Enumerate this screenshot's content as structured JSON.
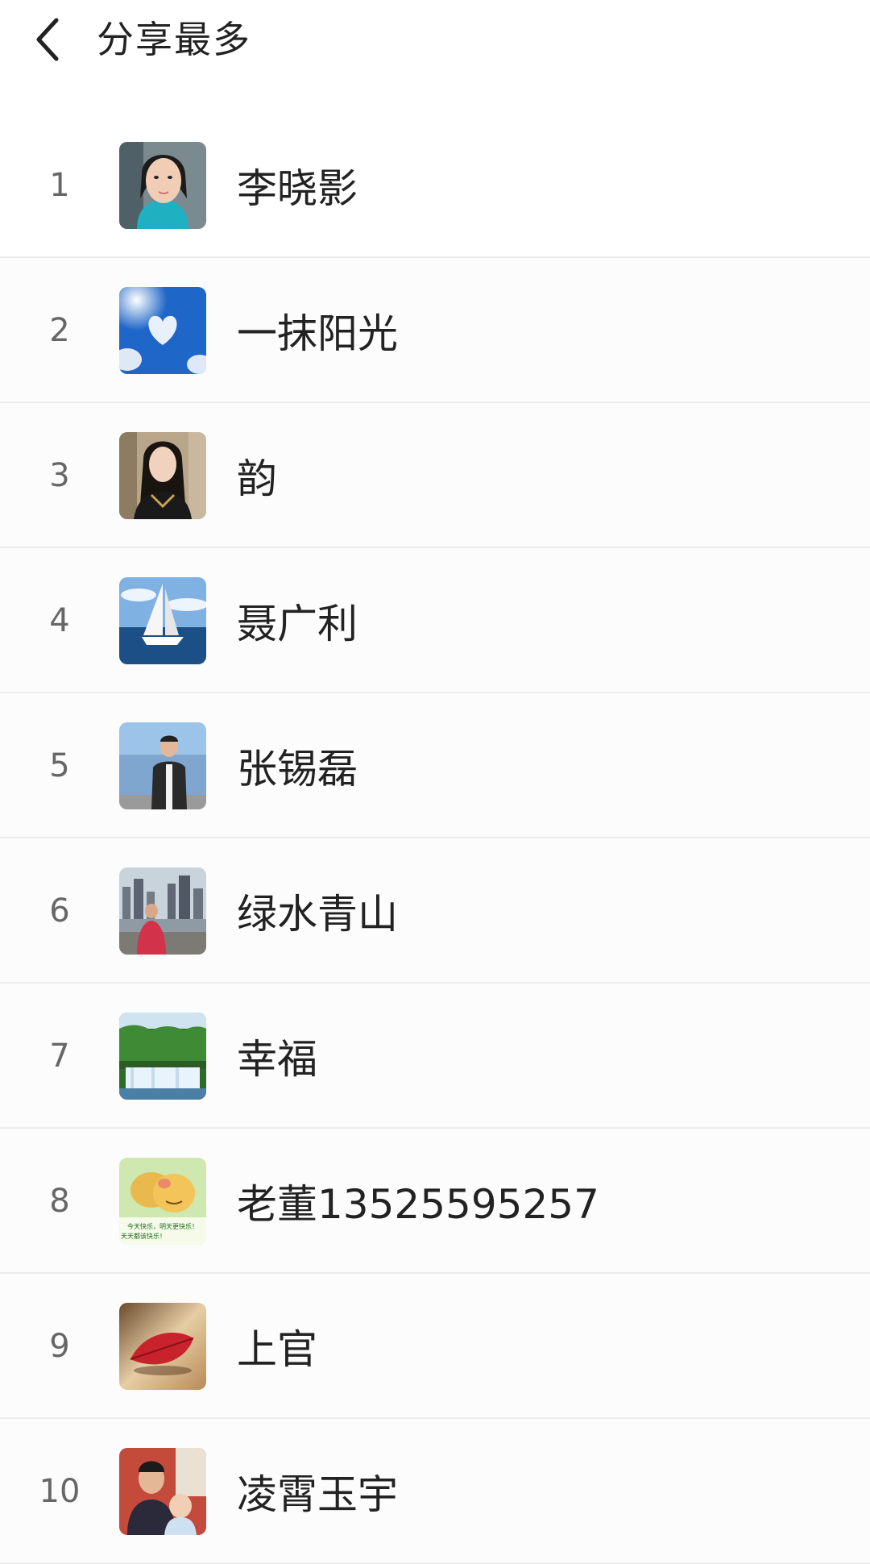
{
  "header": {
    "title": "分享最多",
    "back_icon": "chevron-left-icon"
  },
  "ranking": [
    {
      "rank": "1",
      "name": "李晓影",
      "avatar": "woman-portrait-avatar"
    },
    {
      "rank": "2",
      "name": "一抹阳光",
      "avatar": "heart-cloud-sky-avatar"
    },
    {
      "rank": "3",
      "name": "韵",
      "avatar": "woman-portrait-avatar"
    },
    {
      "rank": "4",
      "name": "聂广利",
      "avatar": "sailboat-avatar"
    },
    {
      "rank": "5",
      "name": "张锡磊",
      "avatar": "man-portrait-avatar"
    },
    {
      "rank": "6",
      "name": "绿水青山",
      "avatar": "city-skyline-avatar"
    },
    {
      "rank": "7",
      "name": "幸福",
      "avatar": "waterfall-forest-avatar"
    },
    {
      "rank": "8",
      "name": "老董13525595257",
      "avatar": "cartoon-bear-avatar",
      "avatar_text": [
        "今天快乐，明天更快乐！",
        "天天都该快乐！"
      ]
    },
    {
      "rank": "9",
      "name": "上官",
      "avatar": "red-leaf-avatar"
    },
    {
      "rank": "10",
      "name": "凌霄玉宇",
      "avatar": "family-photo-avatar"
    }
  ]
}
